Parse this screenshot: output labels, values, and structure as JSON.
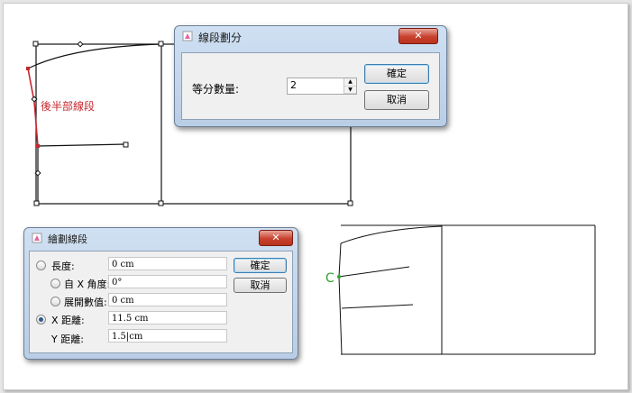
{
  "canvas": {
    "annotation": "後半部線段"
  },
  "dialog_divide": {
    "title": "線段劃分",
    "close_label": "✕",
    "count_label": "等分數量:",
    "count_value": "2",
    "ok_label": "確定",
    "cancel_label": "取消"
  },
  "dialog_draw": {
    "title": "繪劃線段",
    "close_label": "✕",
    "ok_label": "確定",
    "cancel_label": "取消",
    "rows": [
      {
        "label": "長度:",
        "value": "0 cm",
        "selected": false
      },
      {
        "label": "自 X 角度:",
        "value": "0°",
        "selected": false
      },
      {
        "label": "展開數值:",
        "value": "0 cm",
        "selected": false
      },
      {
        "label": "X 距離:",
        "value": "11.5 cm",
        "selected": true
      },
      {
        "label": "Y 距離:",
        "value": "1.5|cm",
        "selected": false
      }
    ]
  },
  "colors": {
    "accent_red": "#c8282d",
    "marker_green": "#2aa52a"
  }
}
